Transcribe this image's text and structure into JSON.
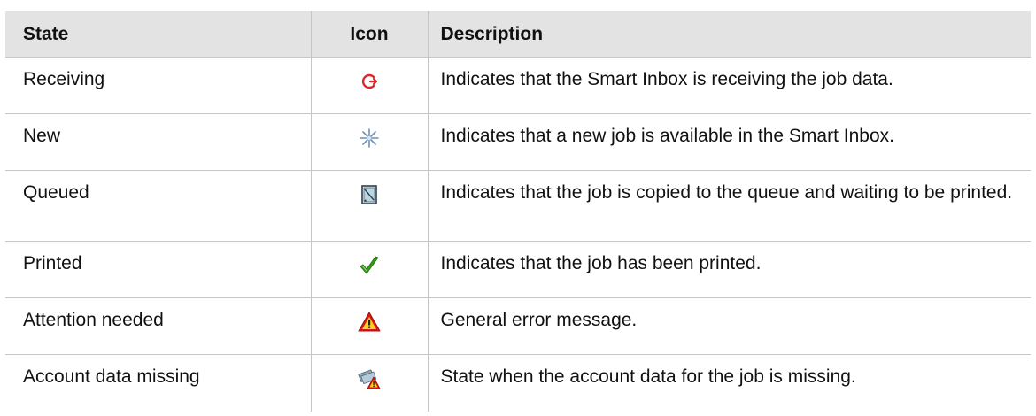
{
  "headers": {
    "state": "State",
    "icon": "Icon",
    "description": "Description"
  },
  "rows": [
    {
      "state": "Receiving",
      "icon": "receiving-icon",
      "description": "Indicates that the Smart Inbox is receiving the job data."
    },
    {
      "state": "New",
      "icon": "new-sparkle-icon",
      "description": "Indicates that a new job is available in the Smart Inbox."
    },
    {
      "state": "Queued",
      "icon": "queued-document-icon",
      "description": "Indicates that the job is copied to the queue and waiting to be printed."
    },
    {
      "state": "Printed",
      "icon": "printed-checkmark-icon",
      "description": "Indicates that the job has been printed."
    },
    {
      "state": "Attention needed",
      "icon": "attention-warning-icon",
      "description": "General error message."
    },
    {
      "state": "Account data missing",
      "icon": "account-data-missing-icon",
      "description": "State when the account data for the job is missing."
    }
  ],
  "colors": {
    "header_bg": "#e3e3e3",
    "border": "#c6c6c6",
    "receiving_red": "#e0262b",
    "check_green": "#3a9a1c",
    "warning_red": "#d8161b",
    "warning_yellow": "#ffd21a"
  }
}
